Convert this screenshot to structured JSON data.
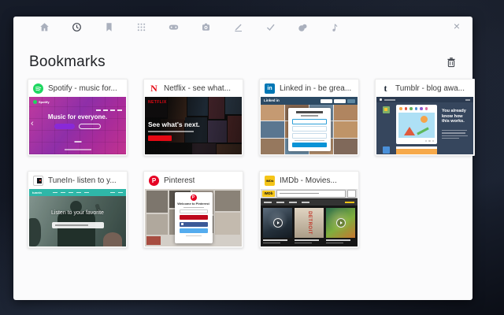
{
  "header": {
    "title": "Bookmarks"
  },
  "toolbar": {
    "icon_names": [
      "home-icon",
      "history-icon",
      "bookmarks-icon",
      "apps-icon",
      "games-icon",
      "camera-icon",
      "edit-icon",
      "tasks-icon",
      "themes-icon",
      "music-icon"
    ],
    "close": "×"
  },
  "colors": {
    "panel_bg": "#fbfbfc",
    "wallpaper": "#10141f",
    "spotify_green": "#1ed760",
    "spotify_magenta": "#a72b9b",
    "netflix_red": "#e50914",
    "linkedin_blue": "#0077b5",
    "linkedin_header": "#2c4a64",
    "tumblr_navy": "#36465d",
    "tunein_teal": "#2fb7a8",
    "pinterest_red": "#bd081c",
    "imdb_yellow": "#f5c518"
  },
  "favicons": {
    "netflix": "N",
    "linkedin": "in",
    "tumblr": "t",
    "pinterest": "P",
    "imdb": "IMDb"
  },
  "bookmarks": [
    {
      "title": "Spotify - music for...",
      "thumb": {
        "logo": "Spotify",
        "headline": "Music for everyone."
      }
    },
    {
      "title": "Netflix - see what...",
      "thumb": {
        "logo": "NETFLIX",
        "headline": "See what's next."
      }
    },
    {
      "title": "Linked in - be grea...",
      "thumb": {
        "logo": "Linked in"
      }
    },
    {
      "title": "Tumblr - blog awa...",
      "thumb": {
        "headline": "You already know how this works."
      }
    },
    {
      "title": "TuneIn- listen to y...",
      "thumb": {
        "logo": "tunein",
        "headline": "Listen to your favorite"
      }
    },
    {
      "title": "Pinterest",
      "thumb": {
        "headline": "Welcome to Pinterest"
      }
    },
    {
      "title": "IMDb - Movies...",
      "thumb": {
        "logo": "IMDb",
        "poster_text": "DETROIT"
      }
    }
  ]
}
